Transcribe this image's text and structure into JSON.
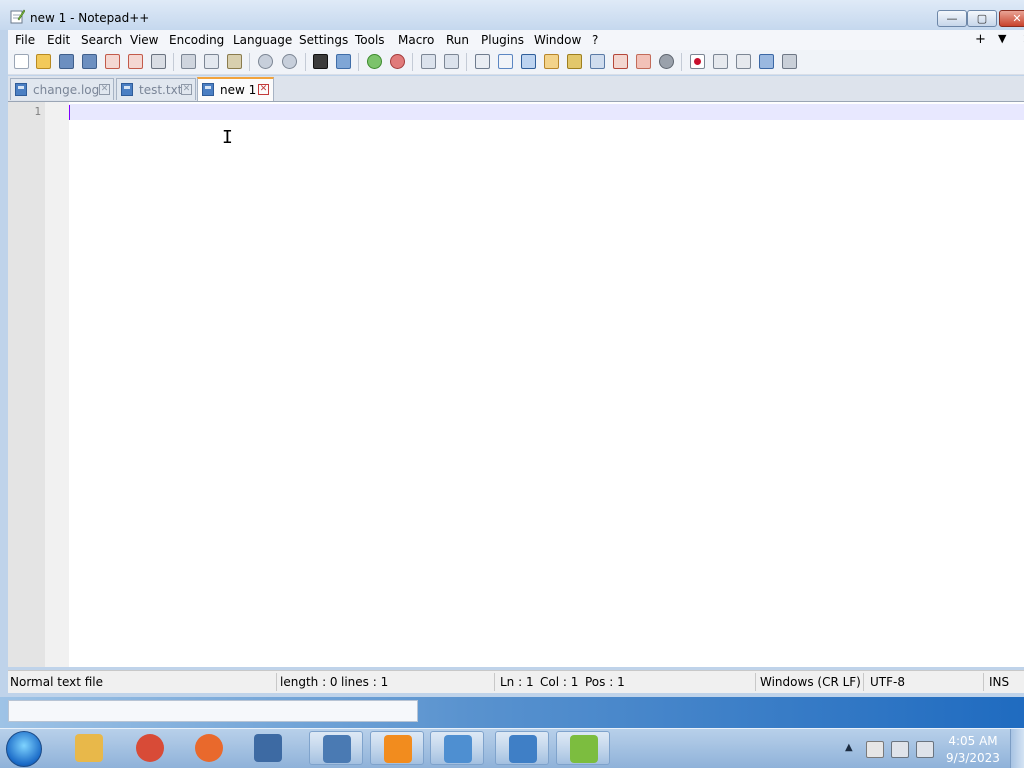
{
  "window": {
    "title": "new 1 - Notepad++",
    "minimize_glyph": "—",
    "maximize_glyph": "▢",
    "close_glyph": "✕"
  },
  "menu": {
    "items": [
      "File",
      "Edit",
      "Search",
      "View",
      "Encoding",
      "Language",
      "Settings",
      "Tools",
      "Macro",
      "Run",
      "Plugins",
      "Window",
      "?"
    ],
    "right_plus": "+",
    "right_down": "▼",
    "right_close": "×"
  },
  "tabs": [
    {
      "label": "change.log",
      "active": false
    },
    {
      "label": "test.txt",
      "active": false
    },
    {
      "label": "new 1",
      "active": true
    }
  ],
  "editor": {
    "line_number": "1",
    "text": "",
    "mouse_cursor": "I"
  },
  "status": {
    "file_type": "Normal text file",
    "length": "length : 0",
    "lines": "lines : 1",
    "ln": "Ln : 1",
    "col": "Col : 1",
    "pos": "Pos : 1",
    "eol": "Windows (CR LF)",
    "encoding": "UTF-8",
    "mode": "INS"
  },
  "clock": {
    "time": "4:05 AM",
    "date": "9/3/2023"
  },
  "taskbar_apps": [
    {
      "name": "file-explorer-icon",
      "color": "#e8b84a"
    },
    {
      "name": "chrome-icon",
      "color": "#d84b37"
    },
    {
      "name": "firefox-icon",
      "color": "#e9692c"
    },
    {
      "name": "virtualbox-icon",
      "color": "#3d6aa3"
    },
    {
      "name": "app-window-icon",
      "color": "#4a7ab3"
    },
    {
      "name": "media-player-icon",
      "color": "#f28c1e"
    },
    {
      "name": "control-panel-icon",
      "color": "#4e8fd1"
    },
    {
      "name": "remote-desktop-icon",
      "color": "#3f7fc6"
    },
    {
      "name": "notepadpp-icon",
      "color": "#7cbd3f"
    }
  ]
}
